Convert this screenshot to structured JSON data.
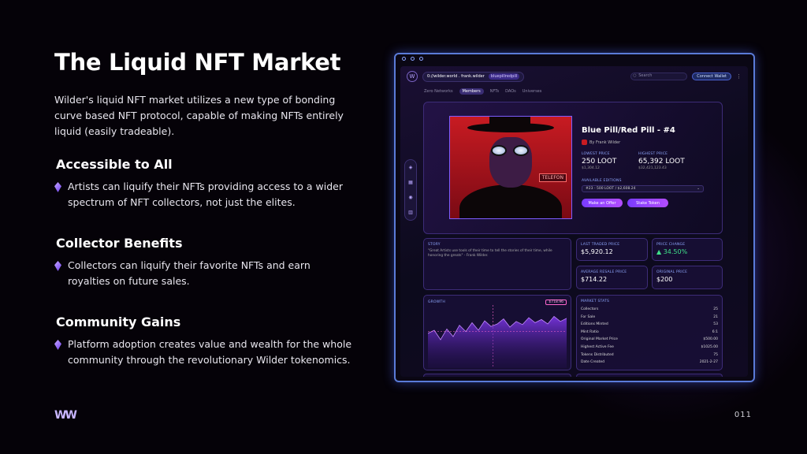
{
  "slide": {
    "title": "The Liquid NFT Market",
    "intro": "Wilder's liquid NFT market utilizes a new type of bonding curve based NFT protocol, capable of making NFTs entirely liquid (easily tradeable).",
    "sections": [
      {
        "heading": "Accessible to All",
        "text": "Artists can liquify their NFTs providing access to a wider spectrum of NFT collectors, not just the elites."
      },
      {
        "heading": "Collector Benefits",
        "text": "Collectors can liquify their favorite NFTs and earn royalties on future sales."
      },
      {
        "heading": "Community Gains",
        "text": "Platform adoption creates value and wealth for the whole community through the revolutionary Wilder tokenomics."
      }
    ],
    "logo": "WW",
    "page_number": "011"
  },
  "app": {
    "address": "0://wilder.world . frank.wilder",
    "address_chip": "bluepillredpill",
    "search_placeholder": "Search",
    "wallet_button": "Connect Wallet",
    "tabs": [
      "Zero Networks",
      "Members",
      "NFTs",
      "DAOs",
      "Universes"
    ],
    "active_tab": 1,
    "sidebar_icons": [
      "compass-icon",
      "grid-icon",
      "lightbulb-icon",
      "building-icon"
    ],
    "nft": {
      "title": "Blue Pill/Red Pill - #4",
      "artist": "By Frank Wilder",
      "sign_text": "TELEFON",
      "lowest_price_label": "Lowest Price",
      "lowest_price": "250 LOOT",
      "lowest_price_usd": "$1,304.12",
      "highest_price_label": "Highest Price",
      "highest_price": "65,392 LOOT",
      "highest_price_usd": "$32,421,123.43",
      "editions_label": "Available Editions",
      "editions_value": "#23 - 500 LOOT / $2,608.24",
      "offer_button": "Make an Offer",
      "stake_button": "Stake Token"
    },
    "story": {
      "label": "Story",
      "text": "\"Great Artists use tools of their time to tell the stories of their time, while honoring the greats\" - Frank Wilder."
    },
    "last_traded": {
      "label": "Last Traded Price",
      "value": "$5,920.12"
    },
    "price_change": {
      "label": "Price Change",
      "value": "34.50%"
    },
    "avg_resale": {
      "label": "Average Resale Price",
      "value": "$714.22"
    },
    "original_price": {
      "label": "Original Price",
      "value": "$200"
    },
    "growth": {
      "label": "Growth",
      "tag": "$718.96",
      "values": [
        0.55,
        0.6,
        0.45,
        0.62,
        0.5,
        0.68,
        0.58,
        0.72,
        0.6,
        0.75,
        0.66,
        0.7,
        0.78,
        0.65,
        0.74,
        0.69,
        0.8,
        0.72,
        0.77,
        0.7,
        0.82,
        0.74,
        0.79
      ]
    },
    "market_stats": {
      "label": "Market Stats",
      "rows": [
        {
          "k": "Collectors",
          "v": "25"
        },
        {
          "k": "For Sale",
          "v": "21"
        },
        {
          "k": "Editions Minted",
          "v": "53"
        },
        {
          "k": "Mint Ratio",
          "v": "6:1"
        },
        {
          "k": "Original Market Price",
          "v": "$500.00"
        },
        {
          "k": "Highest Active Fee",
          "v": "$1025.00"
        },
        {
          "k": "Tokens Distributed",
          "v": "75"
        },
        {
          "k": "Date Created",
          "v": "2021-2-27"
        }
      ]
    }
  }
}
